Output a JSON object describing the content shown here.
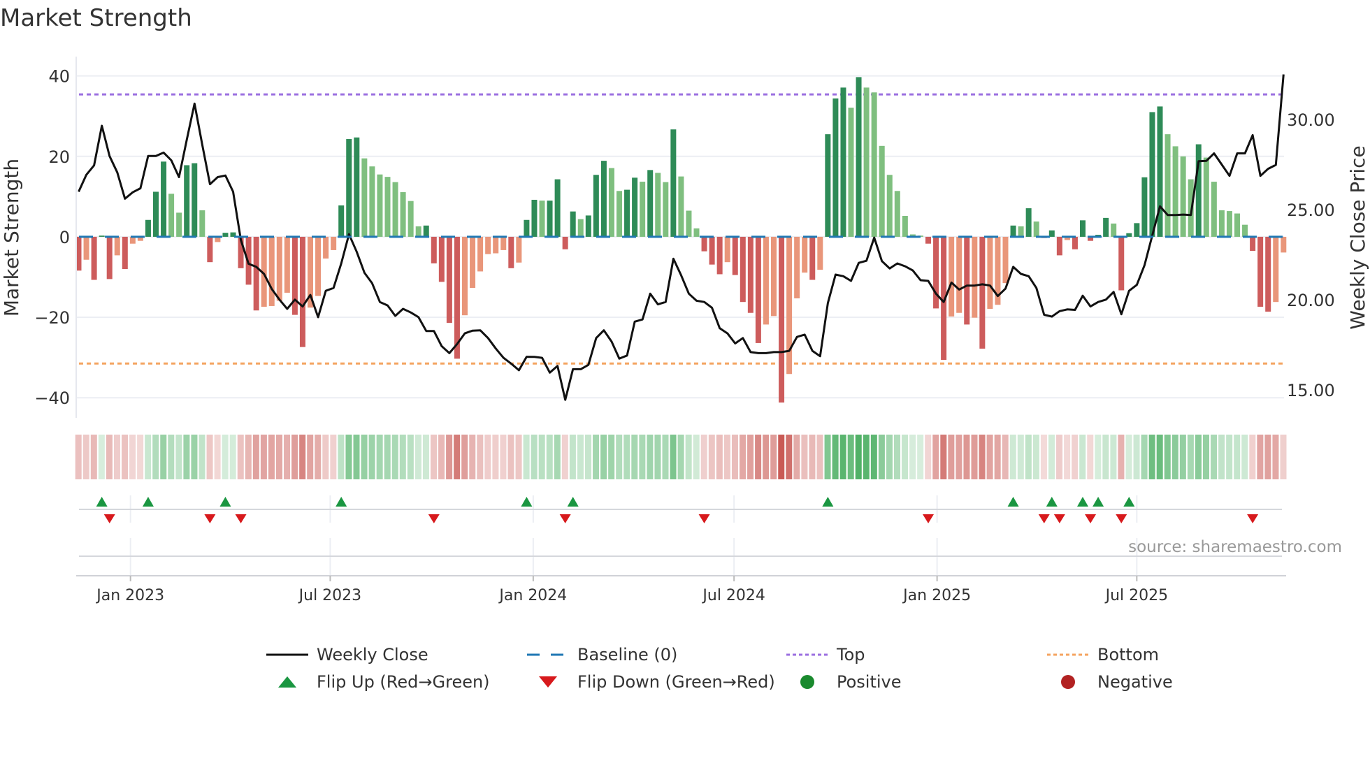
{
  "title": "Market Strength",
  "source": "source: sharemaestro.com",
  "colors": {
    "pos_dark": "#2e8b57",
    "pos_light": "#7fbf7f",
    "neg_dark": "#cd5c5c",
    "neg_light": "#e9967a",
    "baseline": "#1f77b4",
    "top": "#9b6fe0",
    "bottom": "#f4a460",
    "line": "#111111",
    "flip_up": "#1a9641",
    "flip_down": "#d7191c"
  },
  "legend": [
    {
      "label": "Weekly Close",
      "kind": "line"
    },
    {
      "label": "Baseline (0)",
      "kind": "baseline"
    },
    {
      "label": "Top",
      "kind": "top"
    },
    {
      "label": "Bottom",
      "kind": "bottom"
    },
    {
      "label": "Flip Up (Red→Green)",
      "kind": "up"
    },
    {
      "label": "Flip Down (Green→Red)",
      "kind": "down"
    },
    {
      "label": "Positive",
      "kind": "pos"
    },
    {
      "label": "Negative",
      "kind": "neg"
    }
  ],
  "chart_data": {
    "type": "bar",
    "title": "Market Strength",
    "ylabel": "Market Strength",
    "y2label": "Weekly Close Price",
    "frequency": "weekly",
    "start_date": "2022-11-15",
    "ylim": [
      -45,
      44.8
    ],
    "y2lim": [
      13.45,
      33.5
    ],
    "y_ticks": [
      "40",
      "20",
      "0",
      "−20",
      "−40"
    ],
    "y_tick_values": [
      40,
      20,
      0,
      -20,
      -40
    ],
    "y2_ticks": [
      "30.00",
      "25.00",
      "20.00",
      "15.00"
    ],
    "y2_tick_values": [
      30,
      25,
      20,
      15
    ],
    "x_ticks": [
      {
        "label": "Jan 2023",
        "date": "2023-01-01"
      },
      {
        "label": "Jul 2023",
        "date": "2023-07-01"
      },
      {
        "label": "Jan 2024",
        "date": "2024-01-01"
      },
      {
        "label": "Jul 2024",
        "date": "2024-07-01"
      },
      {
        "label": "Jan 2025",
        "date": "2025-01-01"
      },
      {
        "label": "Jul 2025",
        "date": "2025-07-01"
      }
    ],
    "top_level": 35.4,
    "bottom_level": -31.5,
    "baseline": 0,
    "legend_position": "bottom",
    "grid": true,
    "strength": [
      -8.4,
      -5.7,
      -10.7,
      0.3,
      -10.5,
      -4.6,
      -8,
      -1.7,
      -1,
      4.2,
      11.2,
      18.7,
      10.7,
      6,
      17.8,
      18.3,
      6.6,
      -6.3,
      -1.3,
      1,
      1.1,
      -7.8,
      -11.9,
      -18.3,
      -17.4,
      -17.2,
      -15.9,
      -13.9,
      -19.4,
      -27.4,
      -17.6,
      -14.7,
      -5.4,
      -3.3,
      7.8,
      24.3,
      24.7,
      19.5,
      17.5,
      15.5,
      14.9,
      13.6,
      11.1,
      8.9,
      2.6,
      2.8,
      -6.6,
      -11.2,
      -21.4,
      -30.3,
      -19.5,
      -12.7,
      -8.6,
      -4.3,
      -4.1,
      -3.3,
      -7.8,
      -6.4,
      4.2,
      9.2,
      9,
      9,
      14.3,
      -3.1,
      6.3,
      4.4,
      5.3,
      15.4,
      18.9,
      17.1,
      11.4,
      11.7,
      14.7,
      13.7,
      16.6,
      15.9,
      13.6,
      26.7,
      15,
      6.5,
      2.1,
      -3.6,
      -6.9,
      -9.3,
      -6.3,
      -9.5,
      -16.2,
      -18.9,
      -26.4,
      -21.8,
      -19.7,
      -41.2,
      -34.1,
      -15.3,
      -8.9,
      -10.7,
      -8.2,
      25.5,
      34.4,
      37.1,
      32.1,
      39.7,
      37.1,
      35.9,
      22.6,
      15.4,
      11.4,
      5.2,
      0.6,
      0.3,
      -1.7,
      -17.8,
      -30.6,
      -19.8,
      -18.9,
      -21.8,
      -20.1,
      -27.8,
      -17.9,
      -16.9,
      -11.5,
      2.8,
      2.6,
      7.1,
      3.8,
      -0.3,
      1.6,
      -4.6,
      -0.8,
      -3.1,
      4.1,
      -1,
      0.5,
      4.7,
      3.3,
      -13.3,
      0.9,
      3.4,
      14.8,
      31,
      32.4,
      25.5,
      22.5,
      20,
      14.3,
      23,
      19.7,
      13.7,
      6.6,
      6.4,
      5.8,
      3,
      -3.5,
      -17.4,
      -18.6,
      -16.2,
      -3.9
    ],
    "weekly_close": [
      26.0,
      26.94,
      27.46,
      29.66,
      27.98,
      27.07,
      25.61,
      25.97,
      26.19,
      27.98,
      27.98,
      28.17,
      27.74,
      26.81,
      28.88,
      30.89,
      28.62,
      26.42,
      26.81,
      26.9,
      26.0,
      23.32,
      22.0,
      21.83,
      21.44,
      20.6,
      20.01,
      19.5,
      20.01,
      19.63,
      20.27,
      19.04,
      20.5,
      20.66,
      22.02,
      23.64,
      22.67,
      21.5,
      20.92,
      19.88,
      19.69,
      19.11,
      19.5,
      19.3,
      19.04,
      18.27,
      18.27,
      17.43,
      17.04,
      17.55,
      18.14,
      18.29,
      18.31,
      17.88,
      17.3,
      16.78,
      16.46,
      16.09,
      16.84,
      16.83,
      16.78,
      15.96,
      16.33,
      14.45,
      16.15,
      16.15,
      16.39,
      17.88,
      18.31,
      17.68,
      16.74,
      16.91,
      18.79,
      18.91,
      20.34,
      19.75,
      19.88,
      22.28,
      21.37,
      20.34,
      19.95,
      19.88,
      19.56,
      18.42,
      18.14,
      17.58,
      17.88,
      17.1,
      17.04,
      17.04,
      17.1,
      17.1,
      17.17,
      17.94,
      18.07,
      17.17,
      16.87,
      19.82,
      21.4,
      21.31,
      21.05,
      22.05,
      22.17,
      23.45,
      22.15,
      21.74,
      22.02,
      21.86,
      21.63,
      21.09,
      21.05,
      20.34,
      19.88,
      20.96,
      20.57,
      20.79,
      20.79,
      20.86,
      20.79,
      20.21,
      20.62,
      21.83,
      21.44,
      21.31,
      20.66,
      19.17,
      19.07,
      19.37,
      19.47,
      19.44,
      20.23,
      19.63,
      19.88,
      20.01,
      20.44,
      19.2,
      20.5,
      20.83,
      21.92,
      23.57,
      25.19,
      24.71,
      24.71,
      24.73,
      24.71,
      27.69,
      27.71,
      28.13,
      27.51,
      26.88,
      28.13,
      28.13,
      29.14,
      26.88,
      27.27,
      27.49,
      32.51
    ]
  }
}
